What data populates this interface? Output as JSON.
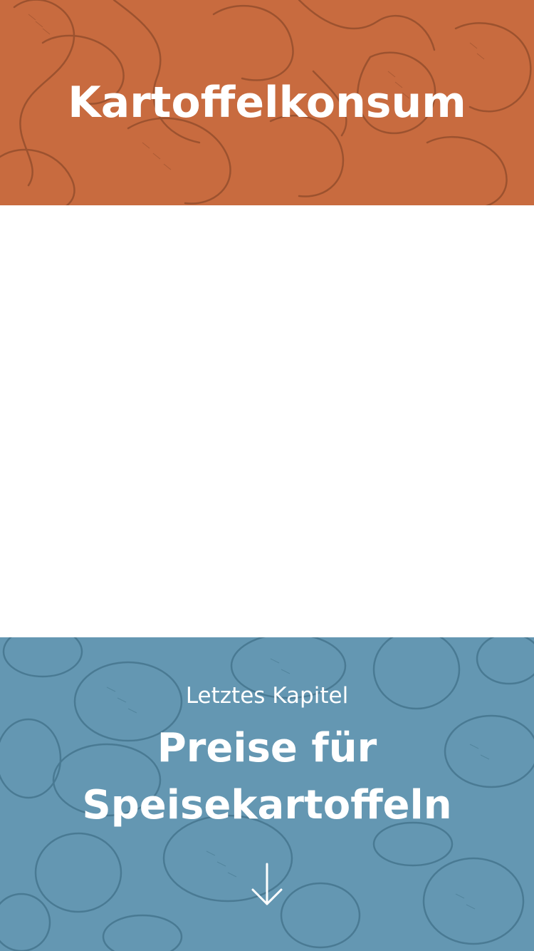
{
  "header": {
    "title": "Kartoffelkonsum",
    "background_color": "#c86b3f",
    "pattern": "potato-chips-sketch"
  },
  "next_chapter": {
    "kicker": "Letztes Kapitel",
    "title": "Preise für Speisekartoffeln",
    "background_color": "#6497b2",
    "pattern": "potatoes-sketch",
    "arrow_icon": "arrow-down-icon"
  }
}
